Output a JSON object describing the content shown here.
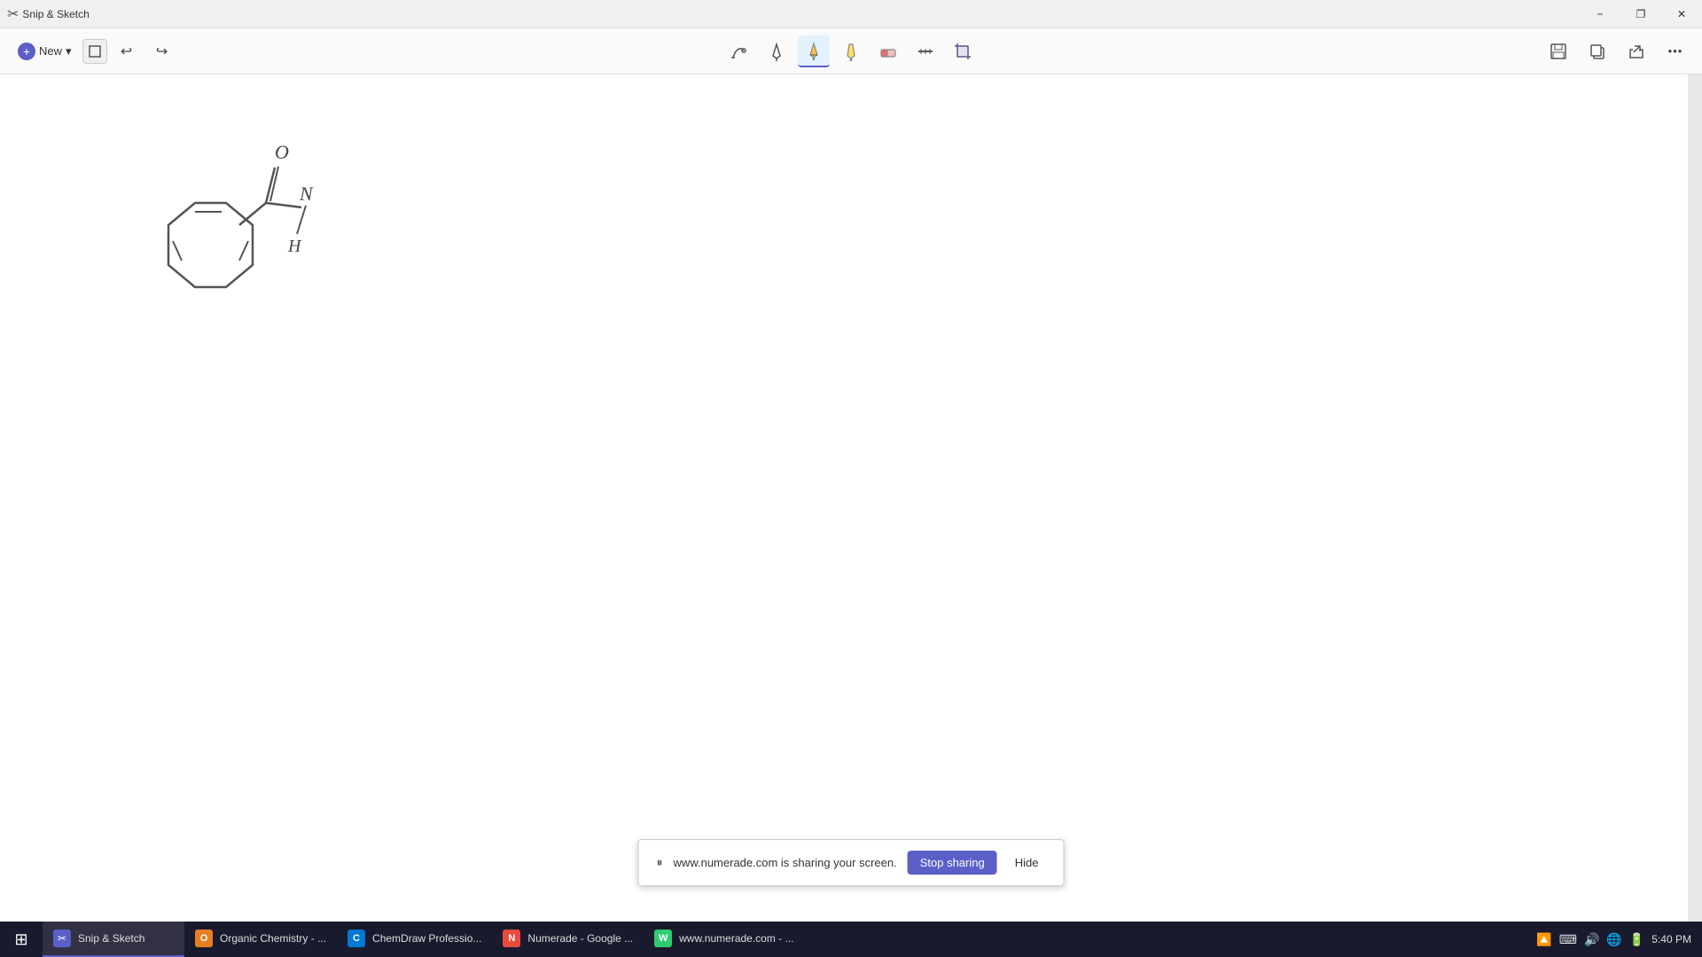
{
  "titlebar": {
    "app_name": "Snip & Sketch",
    "minimize_label": "−",
    "restore_label": "❐",
    "close_label": "✕"
  },
  "toolbar": {
    "new_label": "New",
    "new_dropdown": "▾",
    "undo_label": "↩",
    "redo_label": "↪",
    "tools": [
      {
        "name": "touch-writing",
        "icon": "✋",
        "active": false
      },
      {
        "name": "ballpoint-pen",
        "icon": "✒",
        "active": false
      },
      {
        "name": "pencil",
        "icon": "✏",
        "active": true
      },
      {
        "name": "highlighter",
        "icon": "🖊",
        "active": false
      },
      {
        "name": "eraser",
        "icon": "⬜",
        "active": false
      },
      {
        "name": "ruler",
        "icon": "📐",
        "active": false
      },
      {
        "name": "crop",
        "icon": "⊹",
        "active": false
      }
    ],
    "save_icon": "💾",
    "copy_icon": "📋",
    "share_icon": "↗",
    "more_icon": "..."
  },
  "sharing": {
    "message": "www.numerade.com is sharing your screen.",
    "stop_label": "Stop sharing",
    "hide_label": "Hide"
  },
  "taskbar": {
    "start_icon": "⊞",
    "items": [
      {
        "label": "Snip & Sketch",
        "icon": "✂",
        "icon_bg": "#5b5fc7",
        "active": true
      },
      {
        "label": "Organic Chemistry - ...",
        "icon": "O",
        "icon_bg": "#e67e22",
        "active": false
      },
      {
        "label": "ChemDraw Professio...",
        "icon": "C",
        "icon_bg": "#0078d4",
        "active": false
      },
      {
        "label": "Numerade - Google ...",
        "icon": "N",
        "icon_bg": "#e74c3c",
        "active": false
      },
      {
        "label": "www.numerade.com - ...",
        "icon": "W",
        "icon_bg": "#2ecc71",
        "active": false
      }
    ],
    "time": "5:40 PM",
    "sys_icons": [
      "🔼",
      "⌨",
      "🔊",
      "🌐",
      "🔋"
    ]
  }
}
